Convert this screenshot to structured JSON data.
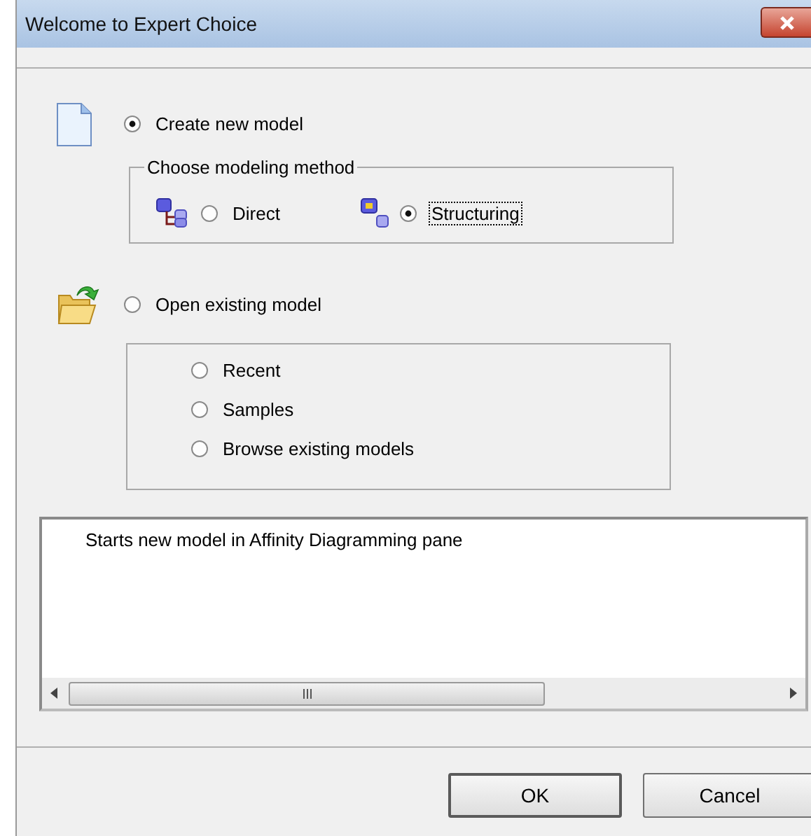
{
  "window": {
    "title": "Welcome to Expert Choice"
  },
  "create_option": {
    "label": "Create new model",
    "selected": true
  },
  "modeling_method": {
    "legend": "Choose modeling method",
    "options": [
      {
        "label": "Direct",
        "kind": "tree",
        "selected": false,
        "focused": false
      },
      {
        "label": "Structuring",
        "kind": "nodes",
        "selected": true,
        "focused": true
      }
    ]
  },
  "open_option": {
    "label": "Open existing model",
    "selected": false
  },
  "open_choices": [
    {
      "label": "Recent",
      "selected": false
    },
    {
      "label": "Samples",
      "selected": false
    },
    {
      "label": "Browse existing models",
      "selected": false
    }
  ],
  "description": "Starts new model in Affinity Diagramming pane",
  "buttons": [
    {
      "label": "OK",
      "default": true
    },
    {
      "label": "Cancel",
      "default": false
    }
  ]
}
